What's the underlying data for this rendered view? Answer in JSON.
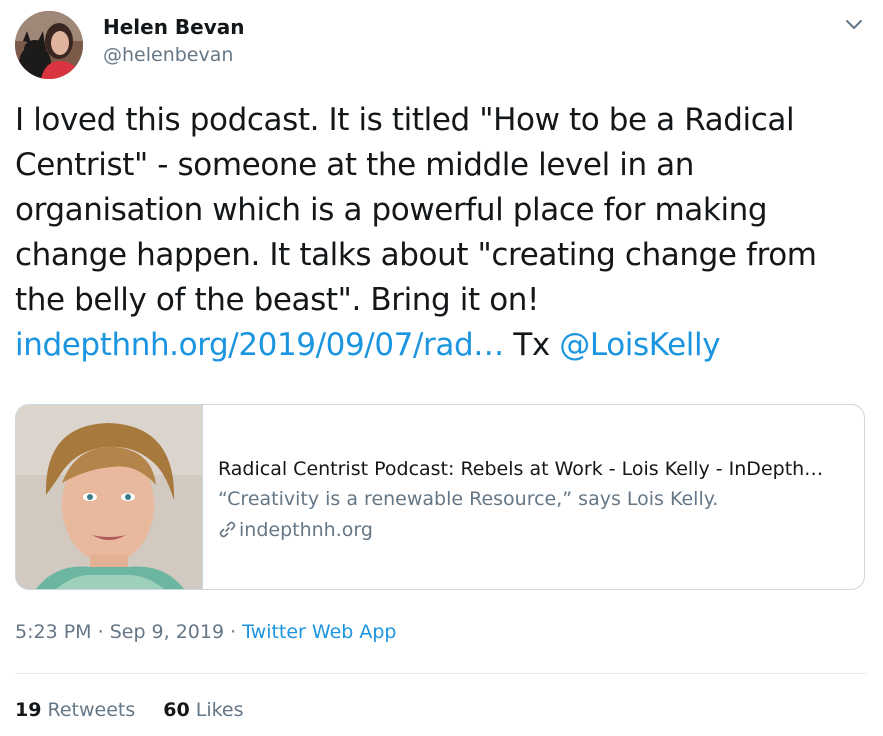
{
  "author": {
    "display_name": "Helen Bevan",
    "handle": "@helenbevan"
  },
  "tweet": {
    "text_line_1": "I loved this podcast. It is titled \"How to be a Radical",
    "text_line_2": "Centrist\" - someone at the middle level in an",
    "text_line_3": "organisation which is a powerful place for making",
    "text_line_4": "change happen. It talks about \"creating change from",
    "text_line_5": "the belly of the beast\". Bring it on!",
    "link_text": "indepthnh.org/2019/09/07/rad…",
    "between_text": " Tx ",
    "mention_text": "@LoisKelly"
  },
  "card": {
    "title": "Radical Centrist Podcast: Rebels at Work - Lois Kelly - InDepth…",
    "description": "“Creativity is a renewable Resource,” says Lois Kelly.",
    "domain": "indepthnh.org"
  },
  "meta": {
    "time": "5:23 PM",
    "sep1": " · ",
    "date": "Sep 9, 2019",
    "sep2": " · ",
    "source": "Twitter Web App"
  },
  "stats": {
    "retweets_count": "19",
    "retweets_label": " Retweets",
    "likes_count": "60",
    "likes_label": " Likes"
  },
  "colors": {
    "link": "#1b95e0",
    "secondary_text": "#657786",
    "primary_text": "#14171a",
    "border": "#ccd6dd"
  },
  "icons": {
    "caret": "chevron-down-icon",
    "link": "link-icon"
  }
}
